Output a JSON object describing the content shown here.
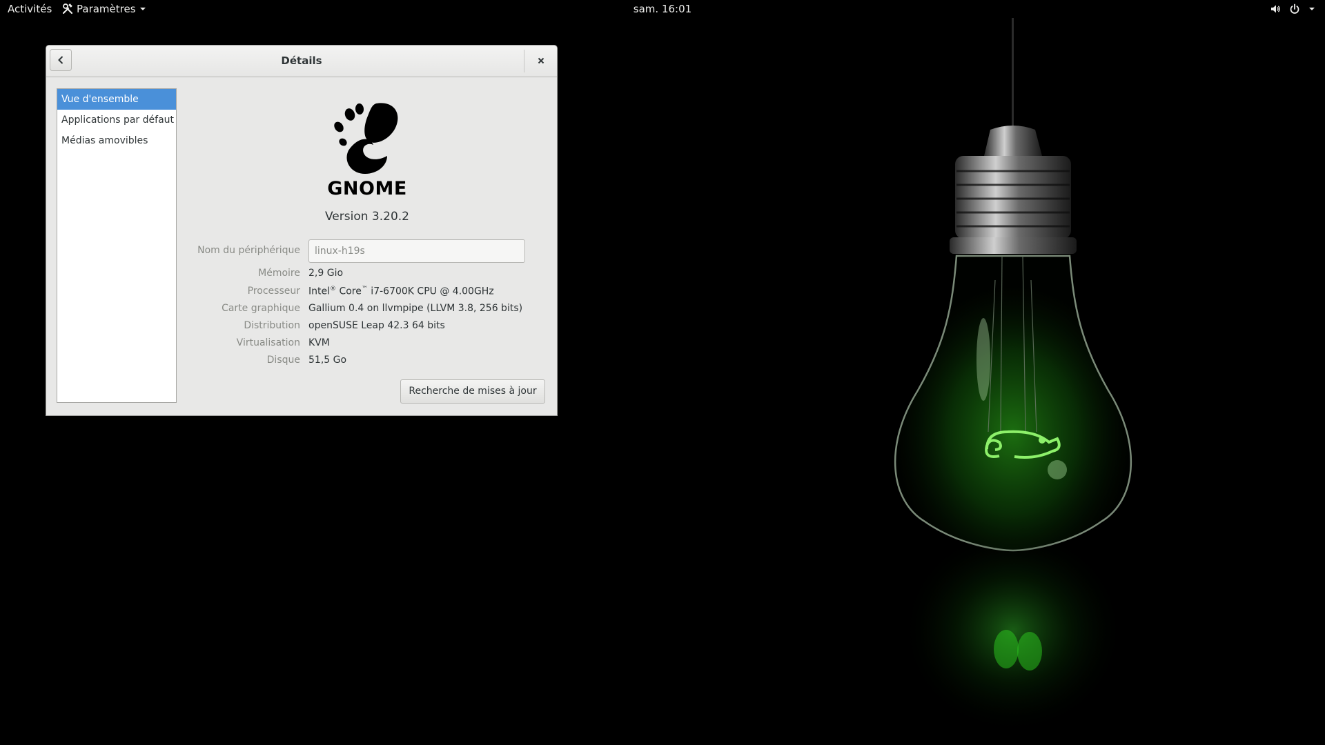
{
  "topbar": {
    "activities": "Activités",
    "app_menu": "Paramètres",
    "clock": "sam. 16:01"
  },
  "window": {
    "title": "Détails",
    "sidebar": {
      "items": [
        {
          "label": "Vue d'ensemble",
          "selected": true
        },
        {
          "label": "Applications par défaut",
          "selected": false
        },
        {
          "label": "Médias amovibles",
          "selected": false
        }
      ]
    },
    "overview": {
      "logo_text": "GNOME",
      "version": "Version 3.20.2",
      "device_name": {
        "label": "Nom du périphérique",
        "value": "linux-h19s"
      },
      "memory": {
        "label": "Mémoire",
        "value": "2,9 Gio"
      },
      "processor": {
        "label": "Processeur",
        "brand": "Intel",
        "reg": "®",
        "family": "Core",
        "tm": "™",
        "model": " i7-6700K CPU @ 4.00GHz"
      },
      "graphics": {
        "label": "Carte graphique",
        "value": "Gallium 0.4 on llvmpipe (LLVM 3.8, 256 bits)"
      },
      "distribution": {
        "label": "Distribution",
        "value": "openSUSE Leap 42.3 64 bits"
      },
      "virtualization": {
        "label": "Virtualisation",
        "value": "KVM"
      },
      "disk": {
        "label": "Disque",
        "value": "51,5 Go"
      },
      "update_button": "Recherche de mises à jour"
    }
  },
  "colors": {
    "selection": "#4a90d9",
    "bulb_glow": "#39d12e",
    "window_bg": "#e8e8e7"
  }
}
